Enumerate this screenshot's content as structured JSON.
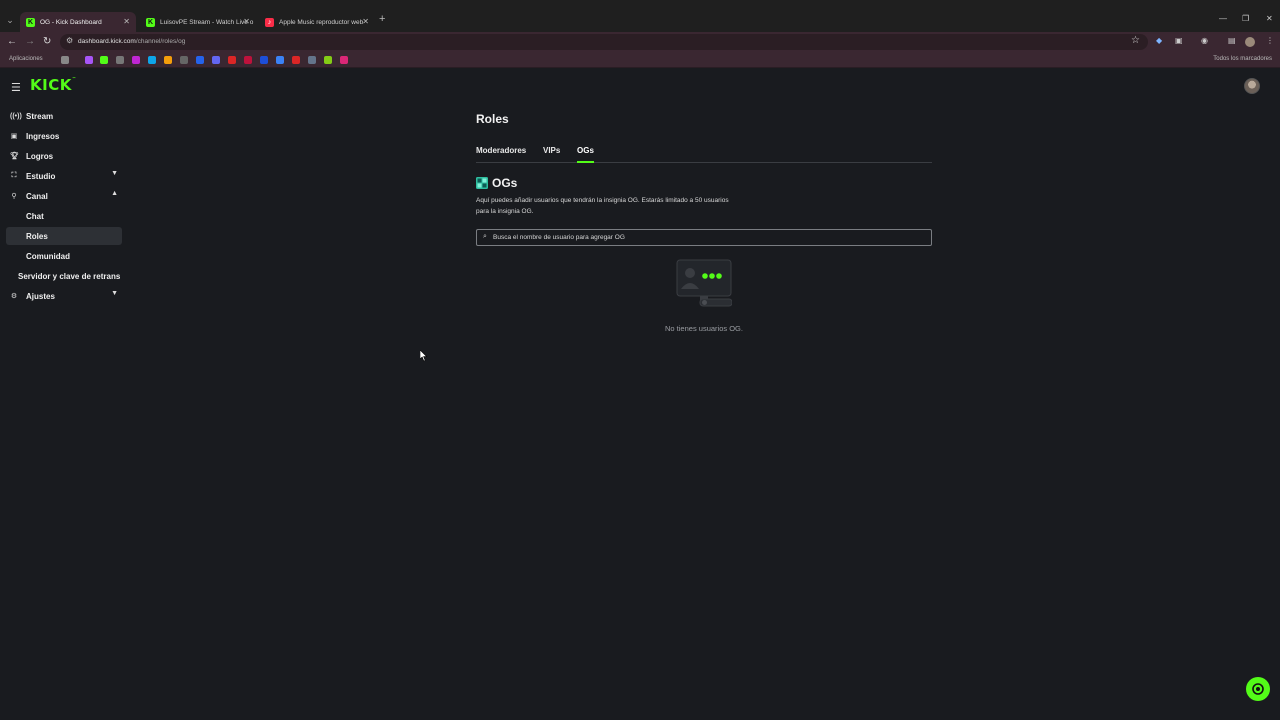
{
  "browser": {
    "tabs": [
      {
        "title": "OG - Kick Dashboard",
        "favicon": "K",
        "active": true
      },
      {
        "title": "LuisovPE Stream - Watch Live o",
        "favicon": "K",
        "active": false
      },
      {
        "title": "Apple Music reproductor web",
        "favicon": "♪",
        "active": false
      }
    ],
    "url_host": "dashboard.kick.com",
    "url_path": "/channel/roles/og",
    "bookmarks_apps": "Aplicaciones",
    "bookmarks_all": "Todos los marcadores"
  },
  "header": {
    "logo": "KICK",
    "logo_tm": "™"
  },
  "sidebar": {
    "items": [
      {
        "label": "Stream",
        "icon": "broadcast-icon"
      },
      {
        "label": "Ingresos",
        "icon": "wallet-icon"
      },
      {
        "label": "Logros",
        "icon": "trophy-icon"
      },
      {
        "label": "Estudio",
        "icon": "studio-icon"
      },
      {
        "label": "Canal",
        "icon": "channel-icon"
      }
    ],
    "canal_sub": [
      {
        "label": "Chat"
      },
      {
        "label": "Roles"
      },
      {
        "label": "Comunidad"
      }
    ],
    "server_key": "Servidor y clave de retrans",
    "settings": {
      "label": "Ajustes",
      "icon": "gear-icon"
    }
  },
  "main": {
    "title": "Roles",
    "tabs": [
      {
        "label": "Moderadores"
      },
      {
        "label": "VIPs"
      },
      {
        "label": "OGs"
      }
    ],
    "section_title": "OGs",
    "description": "Aquí puedes añadir usuarios que tendrán la insignia OG. Estarás limitado a 50 usuarios para la insignia OG.",
    "search_placeholder": "Busca el nombre de usuario para agregar OG",
    "empty_message": "No tienes usuarios OG."
  },
  "colors": {
    "brand": "#53fc18",
    "background": "#191b1f",
    "browser_accent": "#3a2731"
  }
}
